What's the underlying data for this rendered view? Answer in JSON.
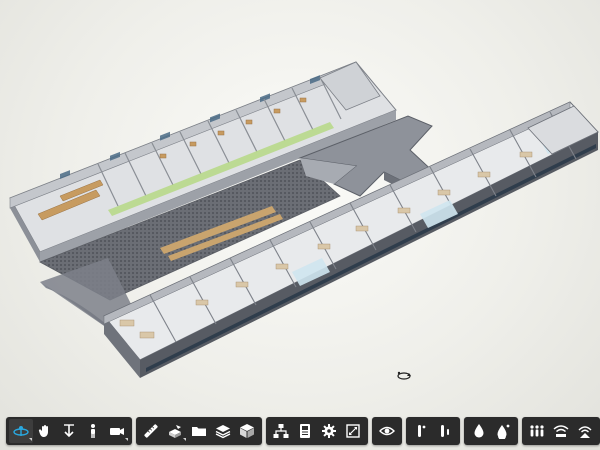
{
  "app": {
    "accent": "#29a8e0",
    "icon_color": "#ffffff"
  },
  "viewport": {
    "model": "building-3d-cutaway"
  },
  "toolbar": {
    "groups": [
      {
        "name": "navigation",
        "buttons": [
          "orbit-icon",
          "pan-icon",
          "zoom-icon",
          "first-person-icon",
          "camera-icon"
        ]
      },
      {
        "name": "measure-section",
        "buttons": [
          "measure-icon",
          "section-icon",
          "folder-icon",
          "layers-icon",
          "model-browser-icon"
        ]
      },
      {
        "name": "model",
        "buttons": [
          "structure-icon",
          "properties-icon",
          "settings-icon",
          "fullscreen-icon"
        ]
      },
      {
        "name": "view",
        "buttons": [
          "eye-icon"
        ]
      },
      {
        "name": "markup",
        "buttons": [
          "markup-pin-icon",
          "markup-bar-icon"
        ]
      },
      {
        "name": "mep",
        "buttons": [
          "water-drop-icon",
          "water-drop-alt-icon"
        ]
      },
      {
        "name": "systems",
        "buttons": [
          "people-icon",
          "wifi-icon",
          "broadcast-icon"
        ]
      }
    ],
    "active_button": "orbit-icon"
  }
}
